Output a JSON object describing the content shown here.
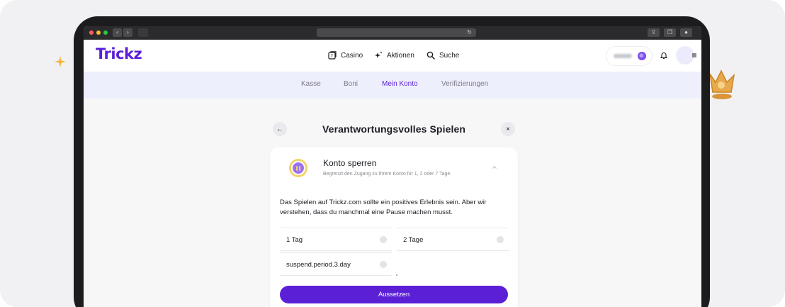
{
  "brand": {
    "logo": "Trickz",
    "accent": "#5b1fd6"
  },
  "browser": {
    "window_controls": [
      "close",
      "minimize",
      "maximize"
    ],
    "nav_glyphs": [
      "‹",
      "›"
    ],
    "toolbar_icons": [
      "share-icon",
      "tabs-icon",
      "download-icon"
    ]
  },
  "topnav": {
    "items": [
      {
        "label": "Casino",
        "icon": "casino-icon"
      },
      {
        "label": "Aktionen",
        "icon": "sparkles-icon"
      },
      {
        "label": "Suche",
        "icon": "search-icon"
      }
    ],
    "balance_icon": "coin-icon",
    "notifications_icon": "bell-icon",
    "menu_icon": "menu-icon"
  },
  "subnav": {
    "tabs": [
      {
        "label": "Kasse",
        "active": false
      },
      {
        "label": "Boni",
        "active": false
      },
      {
        "label": "Mein Konto",
        "active": true
      },
      {
        "label": "Verifizierungen",
        "active": false
      }
    ]
  },
  "modal": {
    "title": "Verantwortungsvolles Spielen",
    "back_glyph": "←",
    "close_glyph": "×",
    "card": {
      "title": "Konto sperren",
      "subtitle": "Begrenzt den Zugang zu Ihrem Konto für 1, 2 oder 7 Tage.",
      "body": "Das Spielen auf Trickz.com sollte ein positives Erlebnis sein. Aber wir verstehen, dass du manchmal eine Pause machen musst.",
      "options": [
        "1 Tag",
        "2 Tage",
        "suspend.period.3.day"
      ],
      "button_label": "Aussetzen"
    }
  }
}
